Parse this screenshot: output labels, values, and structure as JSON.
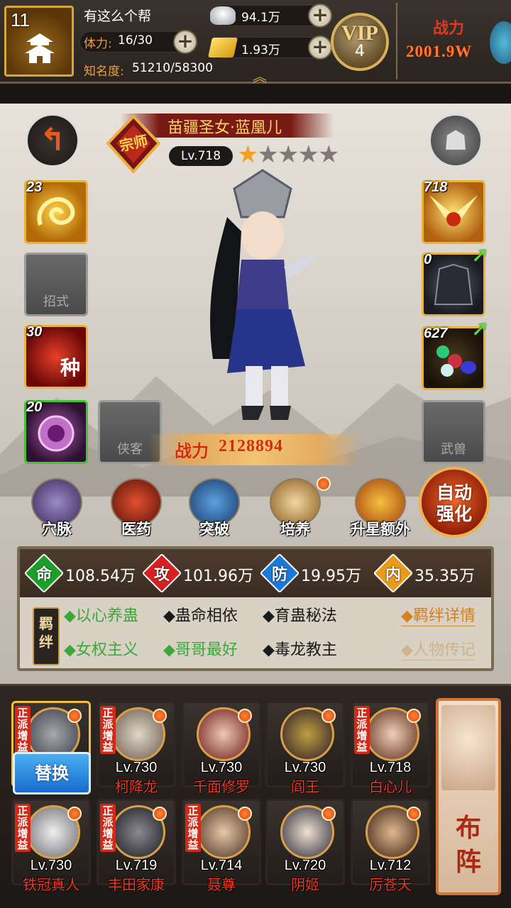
{
  "top": {
    "guild_level": "11",
    "player_name": "有这么个帮",
    "stamina_label": "体力:",
    "stamina_value": "16/30",
    "fame_label": "知名度:",
    "fame_value": "51210/58300",
    "silver": "94.1万",
    "gold": "1.93万",
    "vip_text": "VIP",
    "vip_level": "4",
    "power_label": "战力",
    "power_value": "2001.9W"
  },
  "hero": {
    "rank_char": "宗师",
    "name": "苗疆圣女·蓝凰儿",
    "level": "Lv.718",
    "stars_total": 5,
    "stars_filled": 1,
    "power_label": "战力",
    "power_value": "2128894"
  },
  "slots_left": [
    {
      "count": "23"
    },
    {
      "label": "招式"
    },
    {
      "count": "30",
      "glyph": "种"
    },
    {
      "count": "20"
    }
  ],
  "slot_xiake": "侠客",
  "slots_right": [
    {
      "count": "718"
    },
    {
      "count": "0"
    },
    {
      "count": "627"
    },
    {
      "label": "武兽"
    }
  ],
  "actions": [
    {
      "label": "穴脉"
    },
    {
      "label": "医药"
    },
    {
      "label": "突破"
    },
    {
      "label": "培养"
    },
    {
      "label": "升星额外"
    }
  ],
  "auto_btn": [
    "自动",
    "强化"
  ],
  "stats": [
    {
      "char": "命",
      "value": "108.54万",
      "color": "#1aa02a"
    },
    {
      "char": "攻",
      "value": "101.96万",
      "color": "#d82020"
    },
    {
      "char": "防",
      "value": "19.95万",
      "color": "#1a78d8"
    },
    {
      "char": "内",
      "value": "35.35万",
      "color": "#e89a18"
    }
  ],
  "bond_badge": [
    "羁",
    "绊"
  ],
  "bonds": [
    {
      "text": "◆以心养蛊",
      "active": true
    },
    {
      "text": "◆蛊命相依",
      "active": false
    },
    {
      "text": "◆育蛊秘法",
      "active": false
    },
    {
      "text": "◆女权主义",
      "active": true
    },
    {
      "text": "◆哥哥最好",
      "active": true
    },
    {
      "text": "◆毒龙教主",
      "active": false
    }
  ],
  "bond_links": [
    "◆羁绊详情",
    "◆人物传记"
  ],
  "team": [
    {
      "level": "",
      "name": "",
      "tag": "正派增益"
    },
    {
      "level": "Lv.730",
      "name": "柯降龙",
      "tag": "正派增益"
    },
    {
      "level": "Lv.730",
      "name": "千面修罗",
      "tag": ""
    },
    {
      "level": "Lv.730",
      "name": "阎王",
      "tag": ""
    },
    {
      "level": "Lv.718",
      "name": "白心儿",
      "tag": "正派增益"
    },
    {
      "level": "Lv.730",
      "name": "铁冠真人",
      "tag": "正派增益"
    },
    {
      "level": "Lv.719",
      "name": "丰田家康",
      "tag": "正派增益"
    },
    {
      "level": "Lv.714",
      "name": "聂尊",
      "tag": "正派增益"
    },
    {
      "level": "Lv.720",
      "name": "阴姬",
      "tag": ""
    },
    {
      "level": "Lv.712",
      "name": "厉苍天",
      "tag": ""
    }
  ],
  "replace_label": "替换",
  "formation": [
    "布",
    "阵"
  ],
  "colors": {
    "accent_gold": "#e7b240",
    "bond_active": "#3aa83a",
    "name_red": "#ee3a28"
  }
}
